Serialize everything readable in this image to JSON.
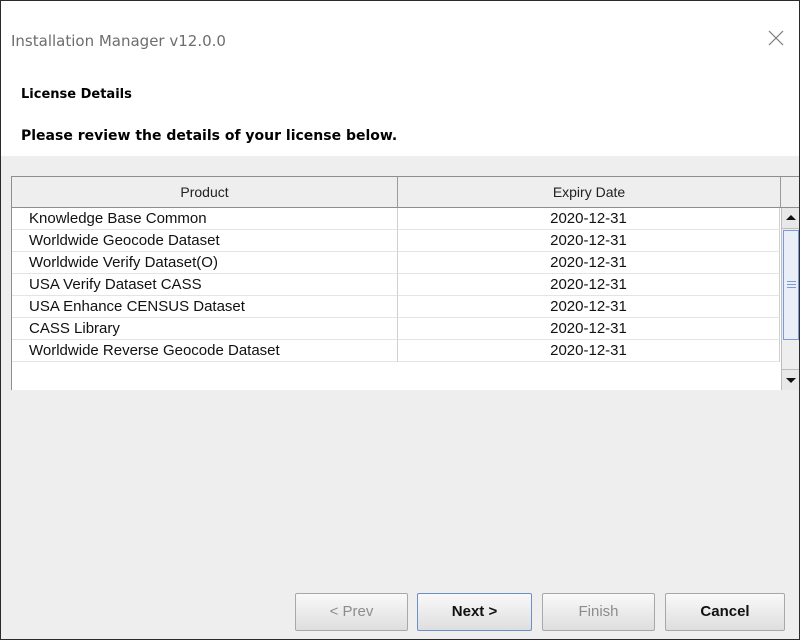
{
  "window": {
    "title": "Installation Manager v12.0.0"
  },
  "header": {
    "section_title": "License Details",
    "description": "Please review the details of your license below."
  },
  "table": {
    "columns": [
      "Product",
      "Expiry Date"
    ],
    "rows": [
      {
        "product": "Knowledge Base Common",
        "expiry": "2020-12-31"
      },
      {
        "product": "Worldwide Geocode Dataset",
        "expiry": "2020-12-31"
      },
      {
        "product": "Worldwide Verify Dataset(O)",
        "expiry": "2020-12-31"
      },
      {
        "product": "USA Verify Dataset CASS",
        "expiry": "2020-12-31"
      },
      {
        "product": "USA Enhance CENSUS Dataset",
        "expiry": "2020-12-31"
      },
      {
        "product": "CASS Library",
        "expiry": "2020-12-31"
      },
      {
        "product": "Worldwide Reverse Geocode Dataset",
        "expiry": "2020-12-31"
      }
    ]
  },
  "buttons": {
    "prev": "< Prev",
    "next": "Next >",
    "finish": "Finish",
    "cancel": "Cancel"
  },
  "icons": {
    "close": "close-icon",
    "scroll_up": "arrow-up-icon",
    "scroll_down": "arrow-down-icon"
  },
  "colors": {
    "scroll_thumb_border": "#7a9ad8",
    "default_button_border": "#6d8fc8",
    "disabled_text": "#8c8c8c"
  }
}
